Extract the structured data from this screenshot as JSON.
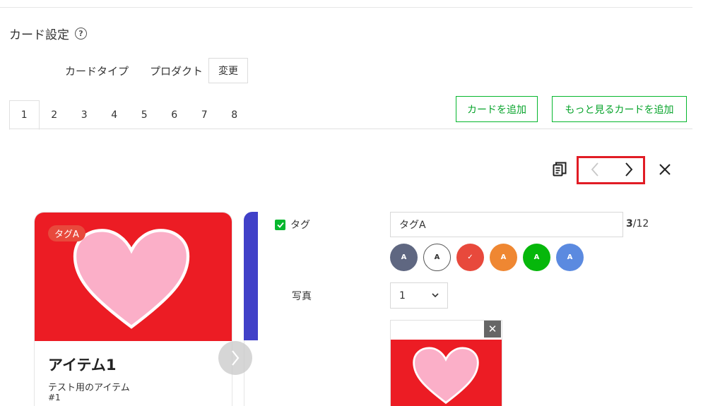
{
  "section": {
    "title": "カード設定",
    "help_icon": "question-circle-icon"
  },
  "card_type": {
    "label": "カードタイプ",
    "value": "プロダクト",
    "change_label": "変更"
  },
  "tabs": [
    {
      "label": "1",
      "active": true
    },
    {
      "label": "2"
    },
    {
      "label": "3"
    },
    {
      "label": "4"
    },
    {
      "label": "5"
    },
    {
      "label": "6"
    },
    {
      "label": "7"
    },
    {
      "label": "8"
    }
  ],
  "actions": {
    "add_card_label": "カードを追加",
    "add_more_card_label": "もっと見るカードを追加"
  },
  "toolbar": {
    "copy_icon": "copy-icon",
    "prev_icon": "chevron-left-icon",
    "next_icon": "chevron-right-icon",
    "close_icon": "close-icon",
    "highlight_color": "#e11c25"
  },
  "card": {
    "tag": "タグA",
    "title": "アイテム1",
    "description": "テスト用のアイテム",
    "number": "#1",
    "image_color": "#ec1c24",
    "next_card_color": "#4040c8"
  },
  "form": {
    "tag_label": "タグ",
    "tag_value": "タグA",
    "tag_count": "3",
    "tag_max": "/12",
    "swatches": [
      {
        "letter": "A",
        "color": "#5f6781"
      },
      {
        "letter": "A",
        "color": "#ffffff"
      },
      {
        "letter": "✓",
        "color": "#e8493c"
      },
      {
        "letter": "A",
        "color": "#ef8732"
      },
      {
        "letter": "A",
        "color": "#06b70b"
      },
      {
        "letter": "A",
        "color": "#5b8ae0"
      }
    ],
    "photo_label": "写真",
    "photo_value": "1",
    "photo_remove": "✕"
  },
  "colors": {
    "accent_green": "#06b72e"
  }
}
